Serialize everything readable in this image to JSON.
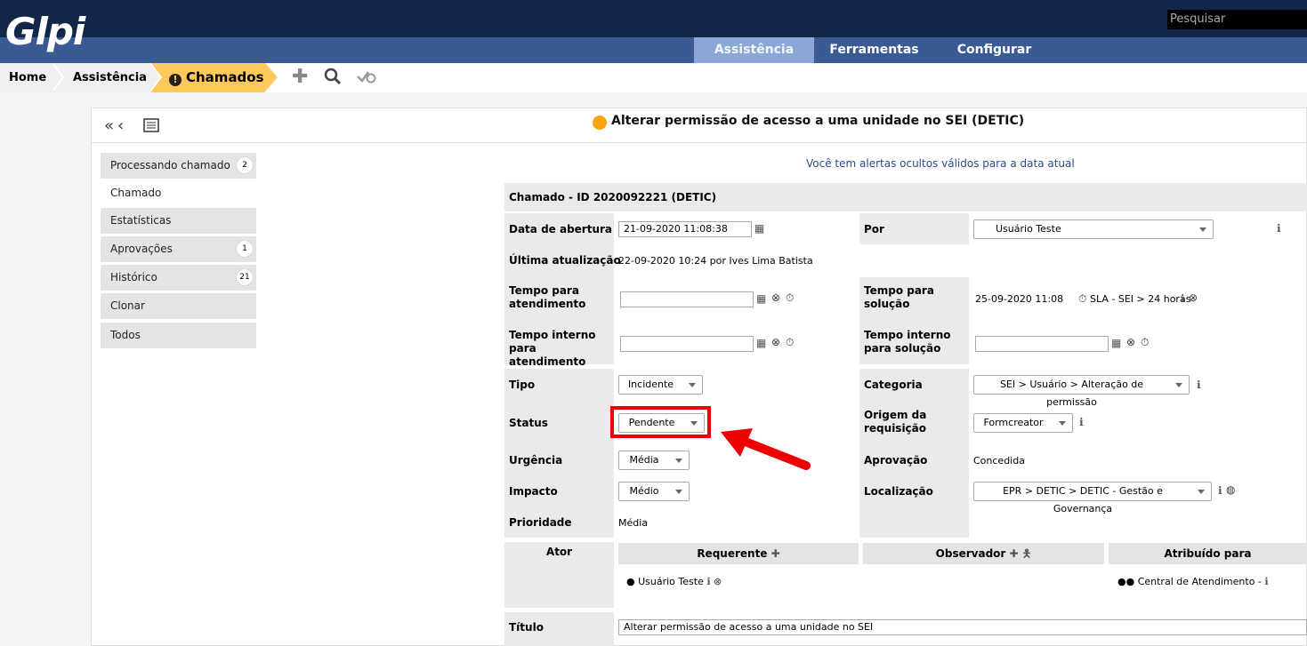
{
  "header": {
    "logo": "Glpi",
    "search_placeholder": "Pesquisar"
  },
  "menu": {
    "assistencia": "Assistência",
    "ferramentas": "Ferramentas",
    "configurar": "Configurar"
  },
  "breadcrumb": {
    "home": "Home",
    "assistencia": "Assistência",
    "chamados": "Chamados"
  },
  "ticket": {
    "title": "Alterar permissão de acesso a uma unidade no SEI (DETIC)",
    "status_color": "#f7a50c"
  },
  "tabs": [
    {
      "label": "Processando chamado",
      "count": "2"
    },
    {
      "label": "Chamado"
    },
    {
      "label": "Estatísticas"
    },
    {
      "label": "Aprovações",
      "count": "1"
    },
    {
      "label": "Histórico",
      "count": "21"
    },
    {
      "label": "Clonar"
    },
    {
      "label": "Todos"
    }
  ],
  "form": {
    "alert": "Você tem alertas ocultos válidos para a data atual",
    "heading": "Chamado - ID 2020092221 (DETIC)",
    "data_abertura_label": "Data de abertura",
    "data_abertura": "21-09-2020 11:08:38",
    "por_label": "Por",
    "por": "Usuário Teste",
    "ultima_label": "Última atualização",
    "ultima": "22-09-2020 10:24 por Ives Lima Batista",
    "tempo_atend_label": "Tempo para atendimento",
    "tempo_sol_label": "Tempo para solução",
    "tempo_sol_value": "25-09-2020 11:08",
    "sla_label": "SLA - SEI > 24 horas",
    "tempo_int_atend_label": "Tempo interno para atendimento",
    "tempo_int_sol_label": "Tempo interno para solução",
    "tipo_label": "Tipo",
    "tipo": "Incidente",
    "categoria_label": "Categoria",
    "categoria": "SEI > Usuário > Alteração de permissão",
    "status_label": "Status",
    "status": "Pendente",
    "origem_label": "Origem da requisição",
    "origem": "Formcreator",
    "urgencia_label": "Urgência",
    "urgencia": "Média",
    "aprovacao_label": "Aprovação",
    "aprovacao": "Concedida",
    "impacto_label": "Impacto",
    "impacto": "Médio",
    "localizacao_label": "Localização",
    "localizacao": "EPR > DETIC > DETIC - Gestão e Governança",
    "prioridade_label": "Prioridade",
    "prioridade": "Média",
    "ator_label": "Ator",
    "requerente_label": "Requerente",
    "observador_label": "Observador",
    "atribuido_label": "Atribuído para",
    "requerente": "Usuário Teste",
    "atribuido": "Central de Atendimento -",
    "titulo_label": "Título",
    "titulo": "Alterar permissão de acesso a uma unidade no SEI"
  }
}
